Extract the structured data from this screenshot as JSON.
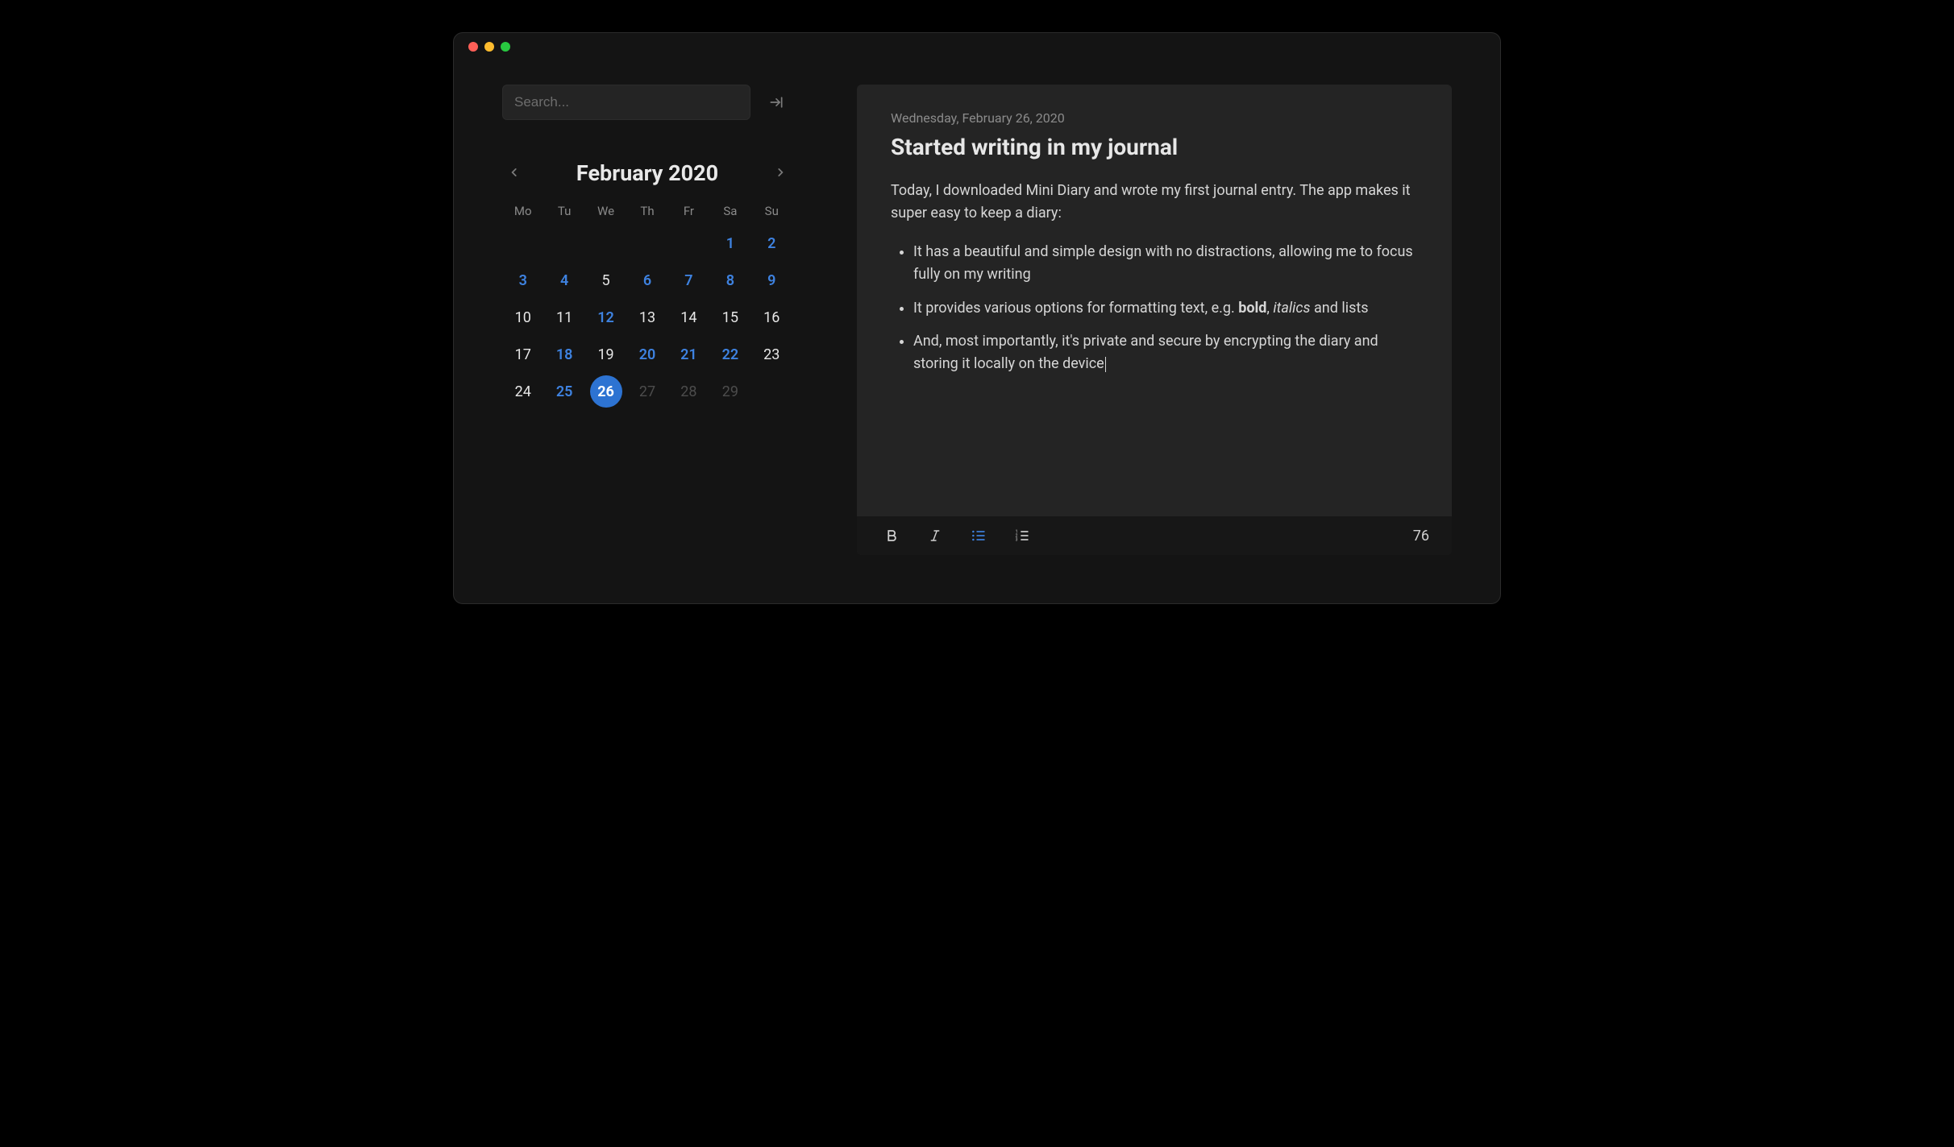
{
  "search": {
    "placeholder": "Search..."
  },
  "calendar": {
    "month_label": "February 2020",
    "weekdays": [
      "Mo",
      "Tu",
      "We",
      "Th",
      "Fr",
      "Sa",
      "Su"
    ],
    "weeks": [
      [
        {
          "n": "",
          "kind": "empty"
        },
        {
          "n": "",
          "kind": "empty"
        },
        {
          "n": "",
          "kind": "empty"
        },
        {
          "n": "",
          "kind": "empty"
        },
        {
          "n": "",
          "kind": "empty"
        },
        {
          "n": "1",
          "kind": "entry"
        },
        {
          "n": "2",
          "kind": "entry"
        }
      ],
      [
        {
          "n": "3",
          "kind": "entry"
        },
        {
          "n": "4",
          "kind": "entry"
        },
        {
          "n": "5",
          "kind": "normal"
        },
        {
          "n": "6",
          "kind": "entry"
        },
        {
          "n": "7",
          "kind": "entry"
        },
        {
          "n": "8",
          "kind": "entry"
        },
        {
          "n": "9",
          "kind": "entry"
        }
      ],
      [
        {
          "n": "10",
          "kind": "normal"
        },
        {
          "n": "11",
          "kind": "normal"
        },
        {
          "n": "12",
          "kind": "entry"
        },
        {
          "n": "13",
          "kind": "normal"
        },
        {
          "n": "14",
          "kind": "normal"
        },
        {
          "n": "15",
          "kind": "normal"
        },
        {
          "n": "16",
          "kind": "normal"
        }
      ],
      [
        {
          "n": "17",
          "kind": "normal"
        },
        {
          "n": "18",
          "kind": "entry"
        },
        {
          "n": "19",
          "kind": "normal"
        },
        {
          "n": "20",
          "kind": "entry"
        },
        {
          "n": "21",
          "kind": "entry"
        },
        {
          "n": "22",
          "kind": "entry"
        },
        {
          "n": "23",
          "kind": "normal"
        }
      ],
      [
        {
          "n": "24",
          "kind": "normal"
        },
        {
          "n": "25",
          "kind": "entry"
        },
        {
          "n": "26",
          "kind": "selected"
        },
        {
          "n": "27",
          "kind": "outside"
        },
        {
          "n": "28",
          "kind": "outside"
        },
        {
          "n": "29",
          "kind": "outside"
        },
        {
          "n": "",
          "kind": "empty"
        }
      ]
    ]
  },
  "entry": {
    "date": "Wednesday, February 26, 2020",
    "title": "Started writing in my journal",
    "paragraph": "Today, I downloaded Mini Diary and wrote my first journal entry. The app makes it super easy to keep a diary:",
    "bullets": [
      {
        "html": "It has a beautiful and simple design with no distractions, allowing me to focus fully on my writing"
      },
      {
        "html": "It provides various options for formatting text, e.g. <strong>bold</strong>, <em>italics</em> and lists"
      },
      {
        "html": "And, most importantly, it's private and secure by encrypting the diary and storing it locally on the device"
      }
    ]
  },
  "toolbar": {
    "word_count": "76"
  }
}
